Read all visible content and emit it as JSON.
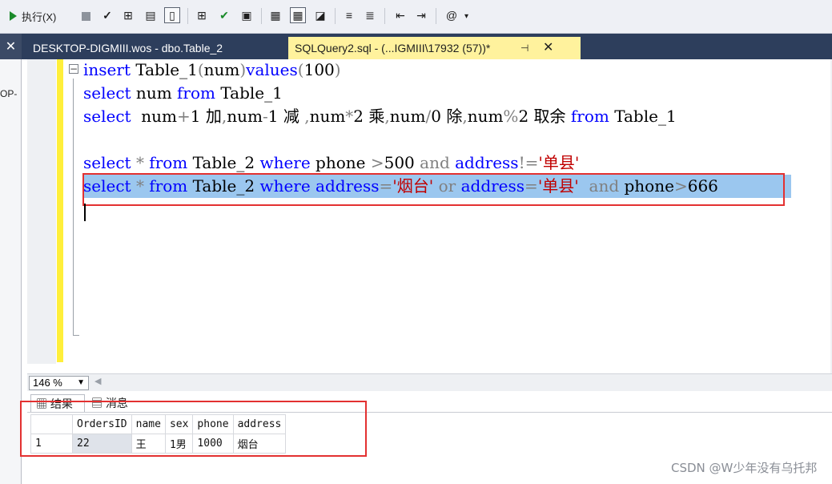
{
  "toolbar": {
    "execute_label": "执行(X)"
  },
  "left_panel": {
    "close_glyph": "✕",
    "partial_text": "OP-"
  },
  "tabs": [
    {
      "label": "DESKTOP-DIGMIII.wos - dbo.Table_2"
    },
    {
      "label": "SQLQuery2.sql - (...IGMIII\\17932 (57))*",
      "pin": "⊣",
      "close": "✕"
    }
  ],
  "editor": {
    "lines": [
      "insert Table_1(num)values(100)",
      "select num from Table_1",
      "select  num+1 加,num-1 减 ,num*2 乘,num/0 除,num%2 取余 from Table_1",
      "",
      "select * from Table_2 where phone >500 and address!='单县'",
      "select * from Table_2 where address='烟台' or address='单县'  and phone>666"
    ]
  },
  "zoom": {
    "value": "146 %"
  },
  "results": {
    "tabs": [
      "结果",
      "消息"
    ],
    "columns": [
      "",
      "OrdersID",
      "name",
      "sex",
      "phone",
      "address"
    ],
    "rows": [
      [
        "1",
        "22",
        "王",
        "1男",
        "1000",
        "烟台"
      ]
    ]
  },
  "watermark": "CSDN @W少年没有乌托邦"
}
